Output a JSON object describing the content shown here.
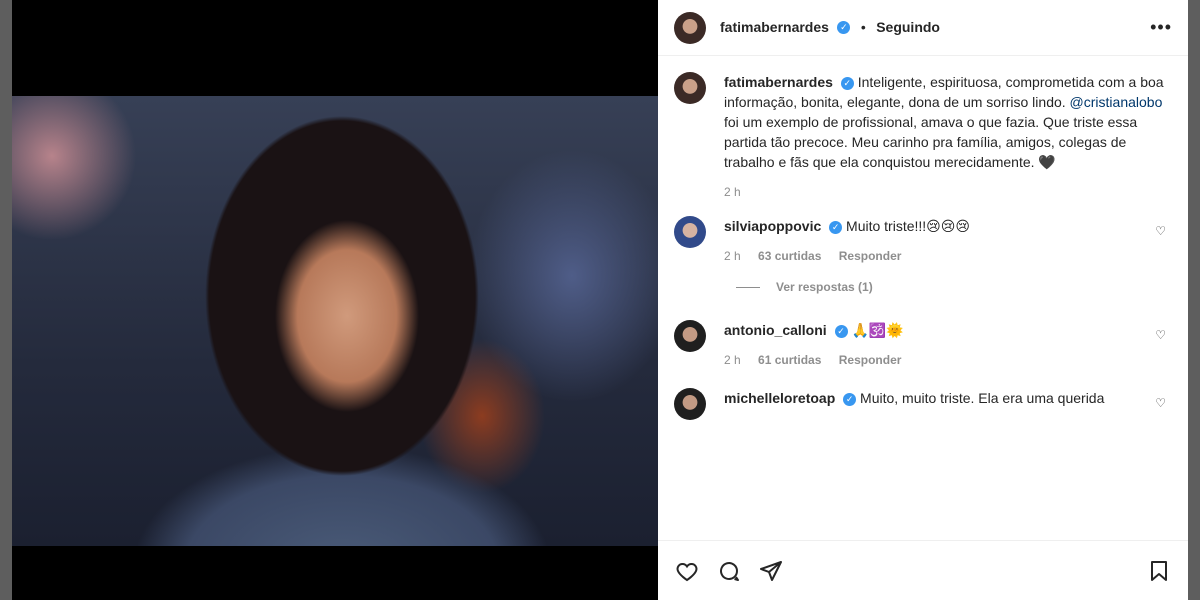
{
  "post": {
    "username": "fatimabernardes",
    "follow_status": "Seguindo",
    "caption_text": "Inteligente, espirituosa, comprometida com a boa informação, bonita, elegante, dona de um sorriso lindo.",
    "mention": "@cristianalobo",
    "caption_rest": "foi um exemplo de profissional, amava o que fazia. Que triste essa partida tão precoce. Meu carinho pra família, amigos, colegas de trabalho e fãs que ela conquistou merecidamente. 🖤",
    "time": "2 h",
    "media_image": "woman-smiling-photo"
  },
  "comments": [
    {
      "username": "silviapoppovic",
      "text": "Muito triste!!!😢😢😢",
      "time": "2 h",
      "likes": "63 curtidas",
      "reply": "Responder",
      "replies": "Ver respostas (1)"
    },
    {
      "username": "antonio_calloni",
      "text": "🙏🕉️🌞",
      "time": "2 h",
      "likes": "61 curtidas",
      "reply": "Responder"
    },
    {
      "username": "michelleloretoap",
      "text": "Muito, muito triste. Ela era uma querida"
    }
  ],
  "actions": {
    "like_icon": "heart-outline-icon",
    "comment_icon": "comment-icon",
    "share_icon": "paper-plane-icon",
    "save_icon": "bookmark-icon"
  },
  "colors": {
    "username": "#262626",
    "secondary": "#8e8e8e",
    "mention": "#00376b",
    "verified": "#3897f0"
  }
}
